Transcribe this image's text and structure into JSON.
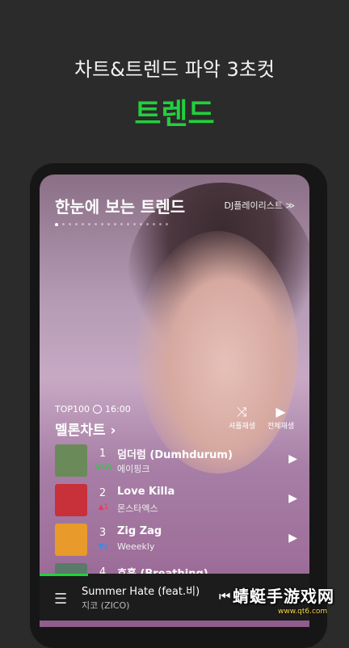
{
  "promo": {
    "headline": "차트&트렌드 파악 3초컷",
    "accent": "트렌드"
  },
  "colors": {
    "accent": "#21d13c",
    "background": "#2b2b2b"
  },
  "trend_section": {
    "title": "한눈에 보는 트렌드",
    "link": "DJ플레이리스트 ≫"
  },
  "chart": {
    "label": "TOP100",
    "time": "16:00",
    "title": "멜론차트 ›",
    "shuffle_label": "셔플재생",
    "play_all_label": "전체재생",
    "rows": [
      {
        "rank": "1",
        "change": "NEW",
        "change_color": "#21d13c",
        "title": "덤더럼 (Dumhdurum)",
        "artist": "에이핑크",
        "art": "#6a8a5a"
      },
      {
        "rank": "2",
        "change": "▲1",
        "change_color": "#e83a5a",
        "title": "Love Killa",
        "artist": "몬스타엑스",
        "art": "#c8303a"
      },
      {
        "rank": "3",
        "change": "▼2",
        "change_color": "#3a8ae8",
        "title": "Zig Zag",
        "artist": "Weeekly",
        "art": "#e89a2a"
      },
      {
        "rank": "4",
        "change": "",
        "change_color": "#ffffff",
        "title": "호흡 (Breathing)",
        "artist": "",
        "art": "#5a7a6a"
      }
    ]
  },
  "player": {
    "song": "Summer Hate (feat.비)",
    "artist": "지코 (ZICO)",
    "progress": 0.18
  },
  "watermark": {
    "text": "蜻蜓手游戏网",
    "url": "www.qt6.com"
  }
}
